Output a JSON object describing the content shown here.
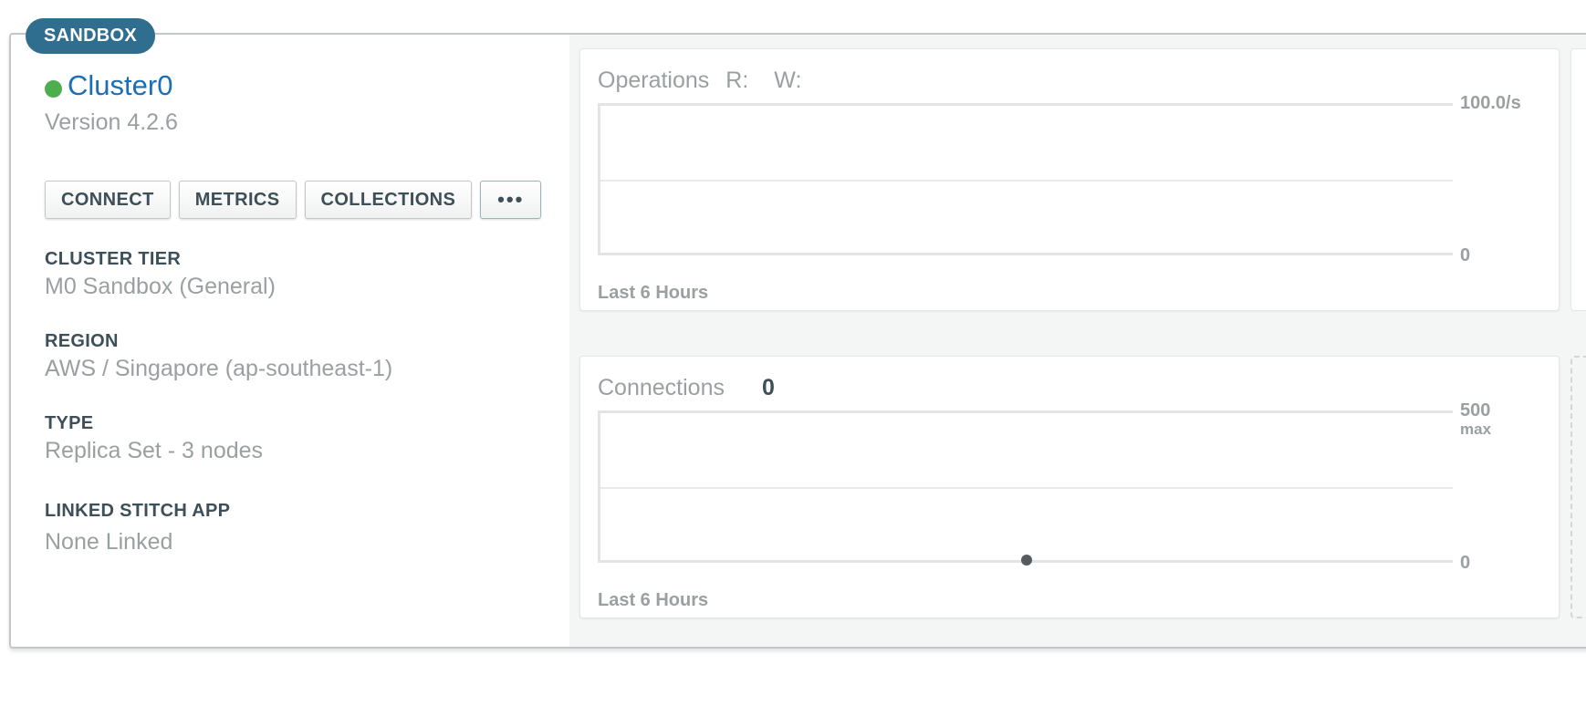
{
  "badge": {
    "label": "SANDBOX"
  },
  "cluster": {
    "name": "Cluster0",
    "status_color": "#4cae4f",
    "version": "Version 4.2.6"
  },
  "buttons": {
    "connect": "CONNECT",
    "metrics": "METRICS",
    "collections": "COLLECTIONS",
    "more": "•••"
  },
  "info": {
    "tier_label": "CLUSTER TIER",
    "tier_value": "M0 Sandbox (General)",
    "region_label": "REGION",
    "region_value": "AWS / Singapore (ap-southeast-1)",
    "type_label": "TYPE",
    "type_value": "Replica Set - 3 nodes",
    "stitch_label": "LINKED STITCH APP",
    "stitch_value": "None Linked"
  },
  "operations_chart": {
    "title": "Operations",
    "read_label": "R:",
    "write_label": "W:",
    "axis_max": "100.0/s",
    "axis_min": "0",
    "footer": "Last 6 Hours"
  },
  "connections_chart": {
    "title": "Connections",
    "current_value": "0",
    "axis_max": "500",
    "axis_max_sub": "max",
    "axis_min": "0",
    "footer": "Last 6 Hours",
    "point_fraction_x": 0.5,
    "point_value": 0
  },
  "colors": {
    "badge_bg": "#2f6e8f",
    "link_blue": "#1a6fb5",
    "status_green": "#4cae4f"
  }
}
